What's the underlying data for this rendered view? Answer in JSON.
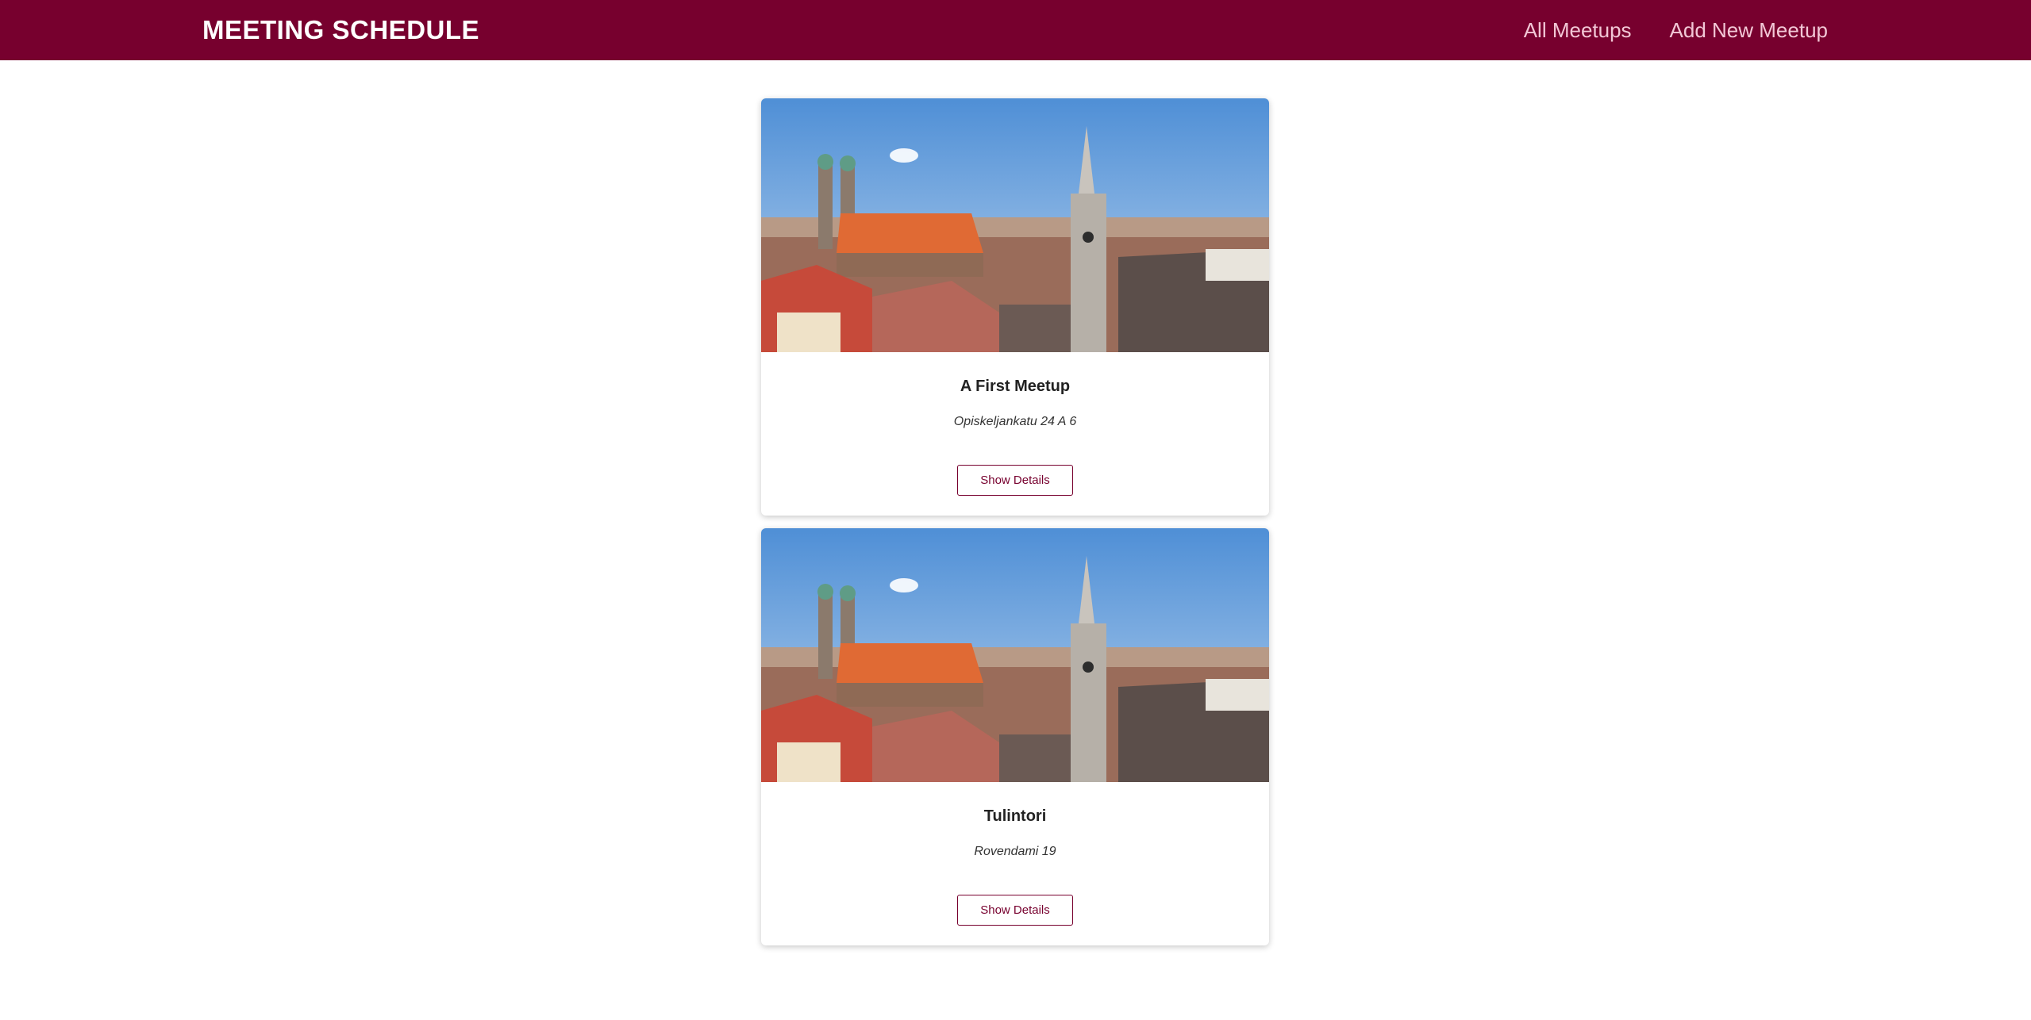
{
  "header": {
    "title": "MEETING SCHEDULE",
    "nav": [
      {
        "label": "All Meetups"
      },
      {
        "label": "Add New Meetup"
      }
    ]
  },
  "meetups": [
    {
      "title": "A First Meetup",
      "address": "Opiskeljankatu 24 A 6",
      "button_label": "Show Details",
      "image": "munich-city-panorama-photo"
    },
    {
      "title": "Tulintori",
      "address": "Rovendami 19",
      "button_label": "Show Details",
      "image": "munich-city-panorama-photo"
    }
  ],
  "colors": {
    "brand": "#77002e",
    "nav_text": "#f2c7d6"
  }
}
